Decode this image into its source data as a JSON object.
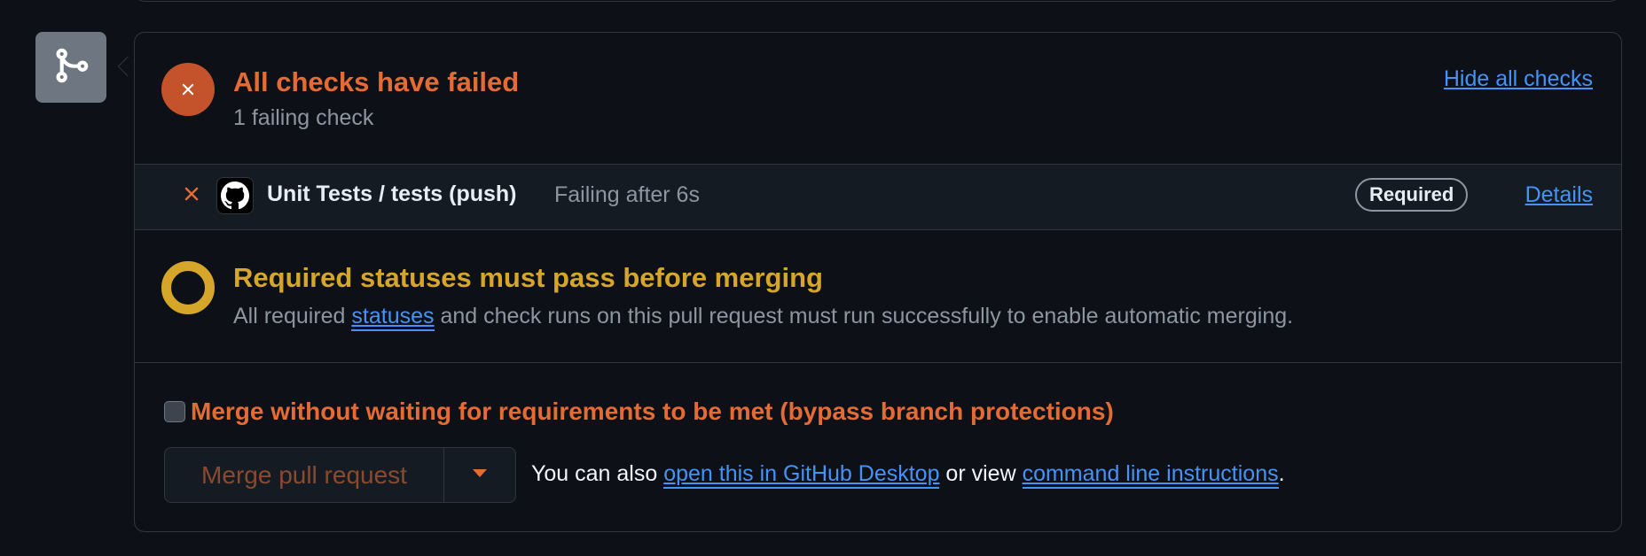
{
  "colors": {
    "background": "#0d1117",
    "border": "#30363d",
    "danger": "#e46b34",
    "fail_circle": "#c4532b",
    "attention": "#d6a62a",
    "link": "#4493f8",
    "muted_text": "#8d96a0"
  },
  "icons": {
    "merge_badge": "git-merge-icon",
    "fail_status": "x-circle-icon",
    "check_fail": "x-icon",
    "check_avatar": "github-icon",
    "pending_status": "dot-ring-icon",
    "dropdown": "triangle-down-icon"
  },
  "checks_summary": {
    "title": "All checks have failed",
    "subtitle": "1 failing check",
    "toggle_label": "Hide all checks"
  },
  "checks": [
    {
      "name": "Unit Tests / tests (push)",
      "status": "Failing after 6s",
      "badge": "Required",
      "details_label": "Details"
    }
  ],
  "required_status": {
    "title": "Required statuses must pass before merging",
    "text_before": "All required ",
    "link": "statuses",
    "text_after": " and check runs on this pull request must run successfully to enable automatic merging."
  },
  "bypass": {
    "label": "Merge without waiting for requirements to be met (bypass branch protections)",
    "checked": false
  },
  "merge": {
    "button_label": "Merge pull request",
    "also_prefix": "You can also ",
    "desktop_link": "open this in GitHub Desktop",
    "or_view": " or view ",
    "cli_link": "command line instructions",
    "suffix": "."
  }
}
